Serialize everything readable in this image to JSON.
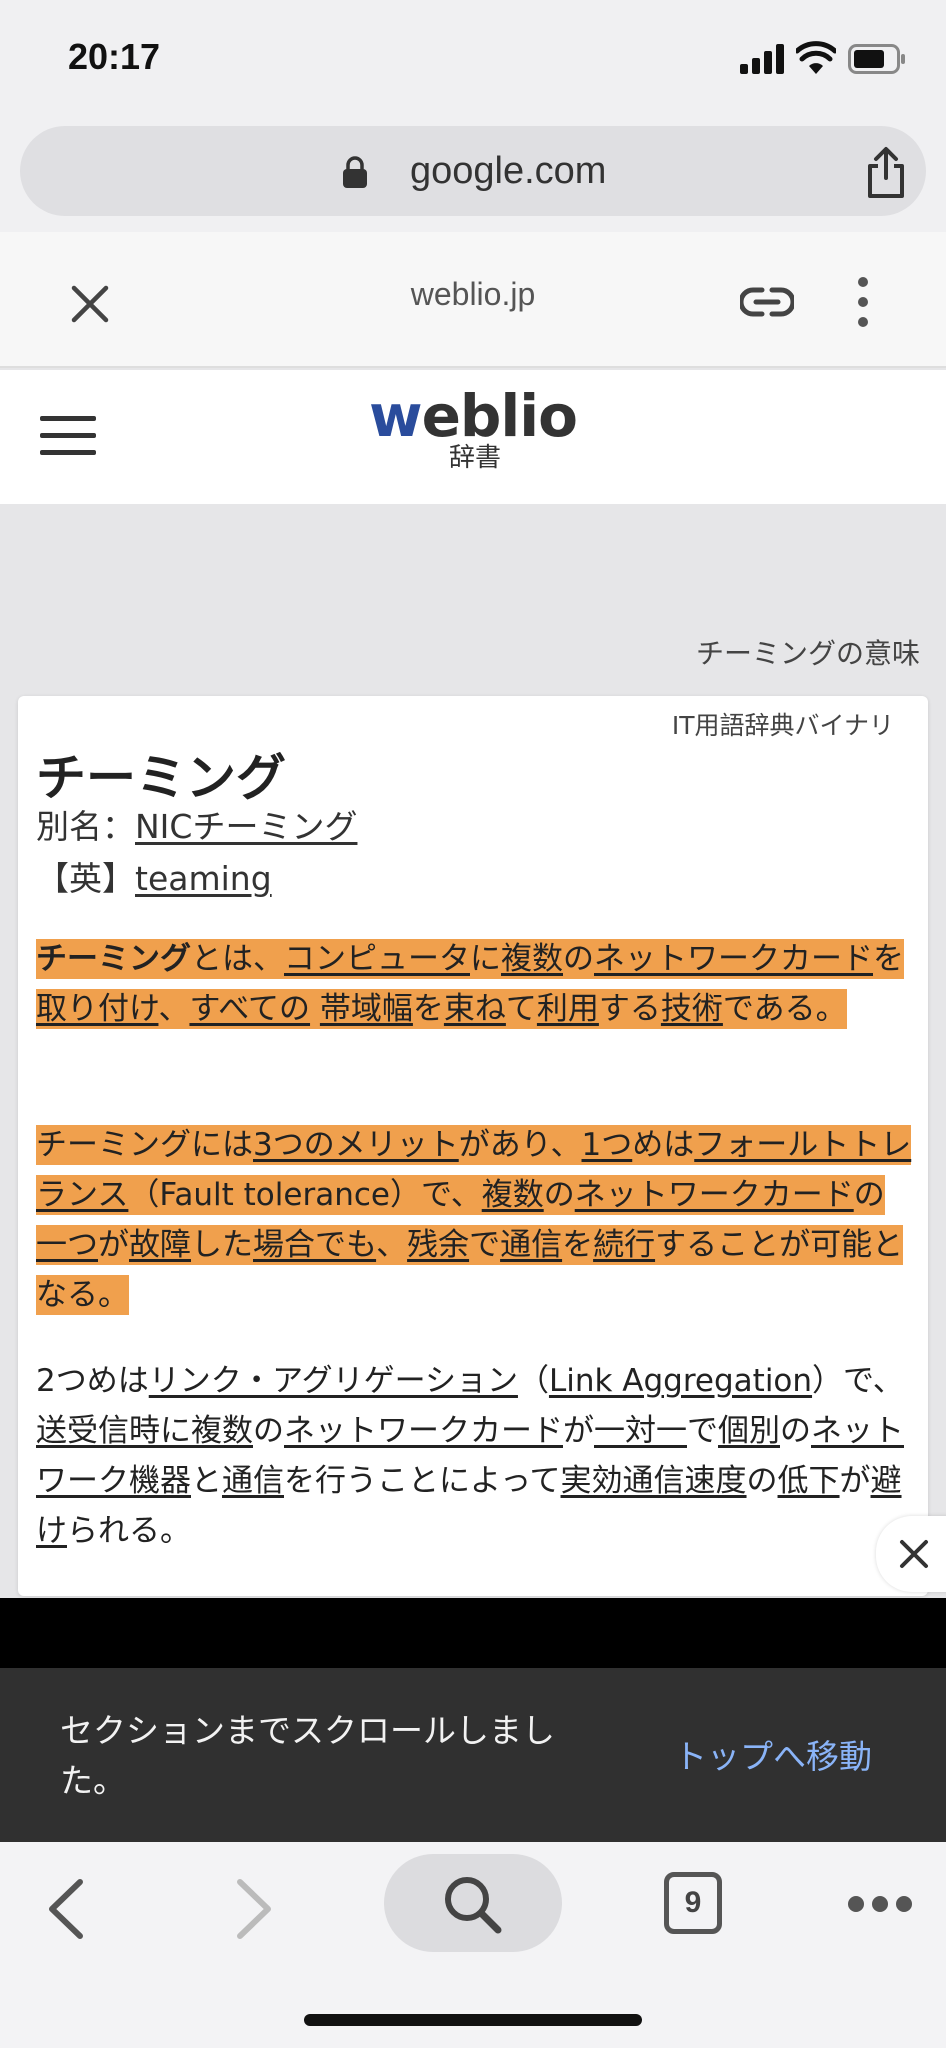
{
  "status": {
    "time": "20:17"
  },
  "browser": {
    "url": "google.com"
  },
  "amp": {
    "domain": "weblio.jp"
  },
  "site": {
    "logo_prefix": "w",
    "logo_rest": "eblio",
    "logo_sub": "辞書"
  },
  "page": {
    "label": "チーミングの意味"
  },
  "entry": {
    "source": "IT用語辞典バイナリ",
    "term": "チーミング",
    "alias_label": "別名：",
    "alias": "NICチーミング",
    "english_label": "【英】",
    "english": "teaming",
    "p1": [
      {
        "t": "チーミング",
        "b": true
      },
      {
        "t": "とは、"
      },
      {
        "t": "コンピュータ",
        "u": true
      },
      {
        "t": "に"
      },
      {
        "t": "複数",
        "u": true
      },
      {
        "t": "の"
      },
      {
        "t": "ネットワークカード",
        "u": true
      },
      {
        "t": "を"
      },
      {
        "t": "取り付け",
        "u": true
      },
      {
        "t": "、"
      },
      {
        "t": "すべての",
        "u": true
      },
      {
        "t": " "
      },
      {
        "t": "帯域幅",
        "u": true
      },
      {
        "t": "を"
      },
      {
        "t": "束ね",
        "u": true
      },
      {
        "t": "て"
      },
      {
        "t": "利用",
        "u": true
      },
      {
        "t": "する"
      },
      {
        "t": "技術",
        "u": true
      },
      {
        "t": "である。"
      }
    ],
    "p2": [
      {
        "t": "チーミングには"
      },
      {
        "t": "3つのメリット",
        "u": true
      },
      {
        "t": "があり、"
      },
      {
        "t": "1つ",
        "u": true
      },
      {
        "t": "めは"
      },
      {
        "t": "フォールトトレランス",
        "u": true
      },
      {
        "t": "（Fault tolerance）で、"
      },
      {
        "t": "複数",
        "u": true
      },
      {
        "t": "の"
      },
      {
        "t": "ネットワークカード",
        "u": true
      },
      {
        "t": "の"
      },
      {
        "t": "一つ",
        "u": true
      },
      {
        "t": "が"
      },
      {
        "t": "故障",
        "u": true
      },
      {
        "t": "した"
      },
      {
        "t": "場合でも",
        "u": true
      },
      {
        "t": "、"
      },
      {
        "t": "残余",
        "u": true
      },
      {
        "t": "で"
      },
      {
        "t": "通信",
        "u": true
      },
      {
        "t": "を"
      },
      {
        "t": "続行",
        "u": true
      },
      {
        "t": "することが可能となる。"
      }
    ],
    "p3": [
      {
        "t": "2つめは"
      },
      {
        "t": "リンク・アグリゲーション",
        "u": true
      },
      {
        "t": "（"
      },
      {
        "t": "Link Aggregation",
        "u": true
      },
      {
        "t": "）で、"
      },
      {
        "t": "送受信時に複数",
        "u": true
      },
      {
        "t": "の"
      },
      {
        "t": "ネットワークカード",
        "u": true
      },
      {
        "t": "が"
      },
      {
        "t": "一対一",
        "u": true
      },
      {
        "t": "で"
      },
      {
        "t": "個別",
        "u": true
      },
      {
        "t": "の"
      },
      {
        "t": "ネットワーク機器",
        "u": true
      },
      {
        "t": "と"
      },
      {
        "t": "通信",
        "u": true
      },
      {
        "t": "を行うことによって"
      },
      {
        "t": "実効通信速度",
        "u": true
      },
      {
        "t": "の"
      },
      {
        "t": "低下",
        "u": true
      },
      {
        "t": "が"
      },
      {
        "t": "避け",
        "u": true
      },
      {
        "t": "られる。"
      }
    ]
  },
  "toast": {
    "message": "セクションまでスクロールしました。",
    "action": "トップへ移動"
  },
  "toolbar": {
    "tab_count": "9"
  },
  "colors": {
    "highlight": "#f0a04d",
    "logo_accent": "#2a4c9c",
    "toast_action": "#8ab4f8"
  }
}
